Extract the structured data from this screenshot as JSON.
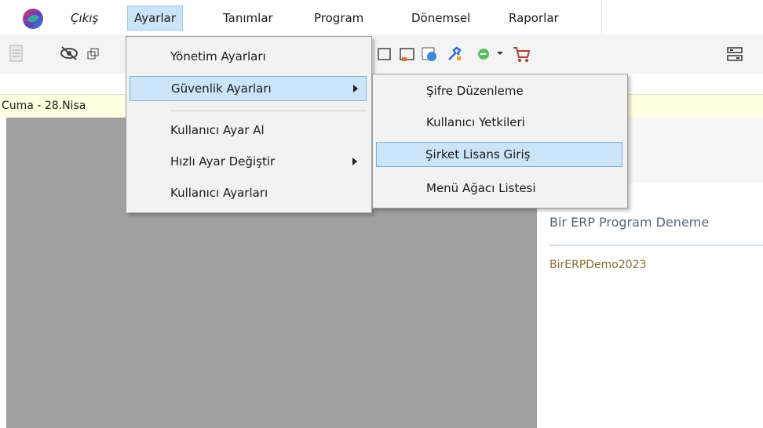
{
  "menubar": {
    "items": [
      {
        "label": "Çıkış"
      },
      {
        "label": "Ayarlar"
      },
      {
        "label": "Tanımlar"
      },
      {
        "label": "Program"
      },
      {
        "label": "Dönemsel"
      },
      {
        "label": "Raporlar"
      }
    ]
  },
  "datebar": {
    "text": "Cuma - 28.Nisa"
  },
  "ayarlar_menu": {
    "items": [
      {
        "label": "Yönetim Ayarları"
      },
      {
        "label": "Güvenlik Ayarları"
      },
      {
        "label": "Kullanıcı Ayar Al"
      },
      {
        "label": "Hızlı Ayar Değiştir"
      },
      {
        "label": "Kullanıcı Ayarları"
      }
    ]
  },
  "guvenlik_submenu": {
    "items": [
      {
        "label": "Şifre Düzenleme"
      },
      {
        "label": "Kullanıcı Yetkileri"
      },
      {
        "label": "Şirket Lisans Giriş"
      },
      {
        "label": "Menü Ağacı Listesi"
      }
    ]
  },
  "program_panel": {
    "title": "Bir ERP Program Deneme",
    "code": "BirERPDemo2023"
  },
  "colors": {
    "highlight": "#cce4f7",
    "datebar": "#ffffe1",
    "workspace": "#a0a0a0"
  }
}
